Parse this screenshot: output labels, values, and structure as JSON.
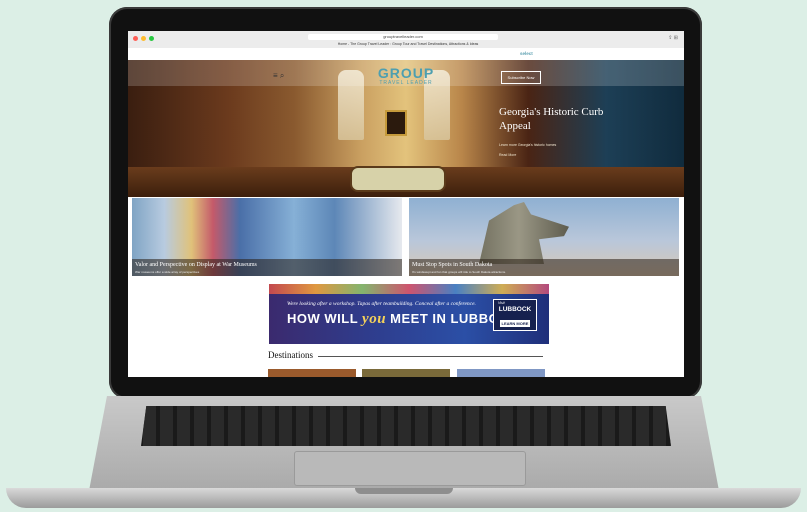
{
  "browser": {
    "url": "grouptravelleader.com",
    "tab_title": "Home - The Group Travel Leader : Group Tour and Travel Destinations, Attractions & Ideas"
  },
  "partners": [
    "",
    "",
    " select"
  ],
  "header": {
    "logo_main": "GROUP",
    "logo_sub": "TRAVEL LEADER",
    "subscribe": "Subscribe Now"
  },
  "hero": {
    "title": "Georgia's Historic Curb Appeal",
    "subtitle": "Learn more Georgia's historic homes",
    "link": "Read More"
  },
  "cards": [
    {
      "title": "Valor and Perspective on Display at War Museums",
      "subtitle": "War museums offer a wide array of perspectives"
    },
    {
      "title": "Must Stop Spots in South Dakota",
      "subtitle": "It's windswept and fun that groups will ride to South Dakota attractions."
    }
  ],
  "ad": {
    "script": "Were looking after a workshop. Tapas after teambuilding. Conceal after a conference.",
    "main_a": "HOW WILL ",
    "main_you": "you",
    "main_b": " MEET IN LUBBOCK?",
    "badge_visit": "Visit",
    "badge_name": "LUBBOCK",
    "badge_cta": "LEARN MORE"
  },
  "sections": {
    "destinations": "Destinations"
  },
  "colors": {
    "background": "#dcefe6",
    "logo": "#4e9fb0"
  }
}
